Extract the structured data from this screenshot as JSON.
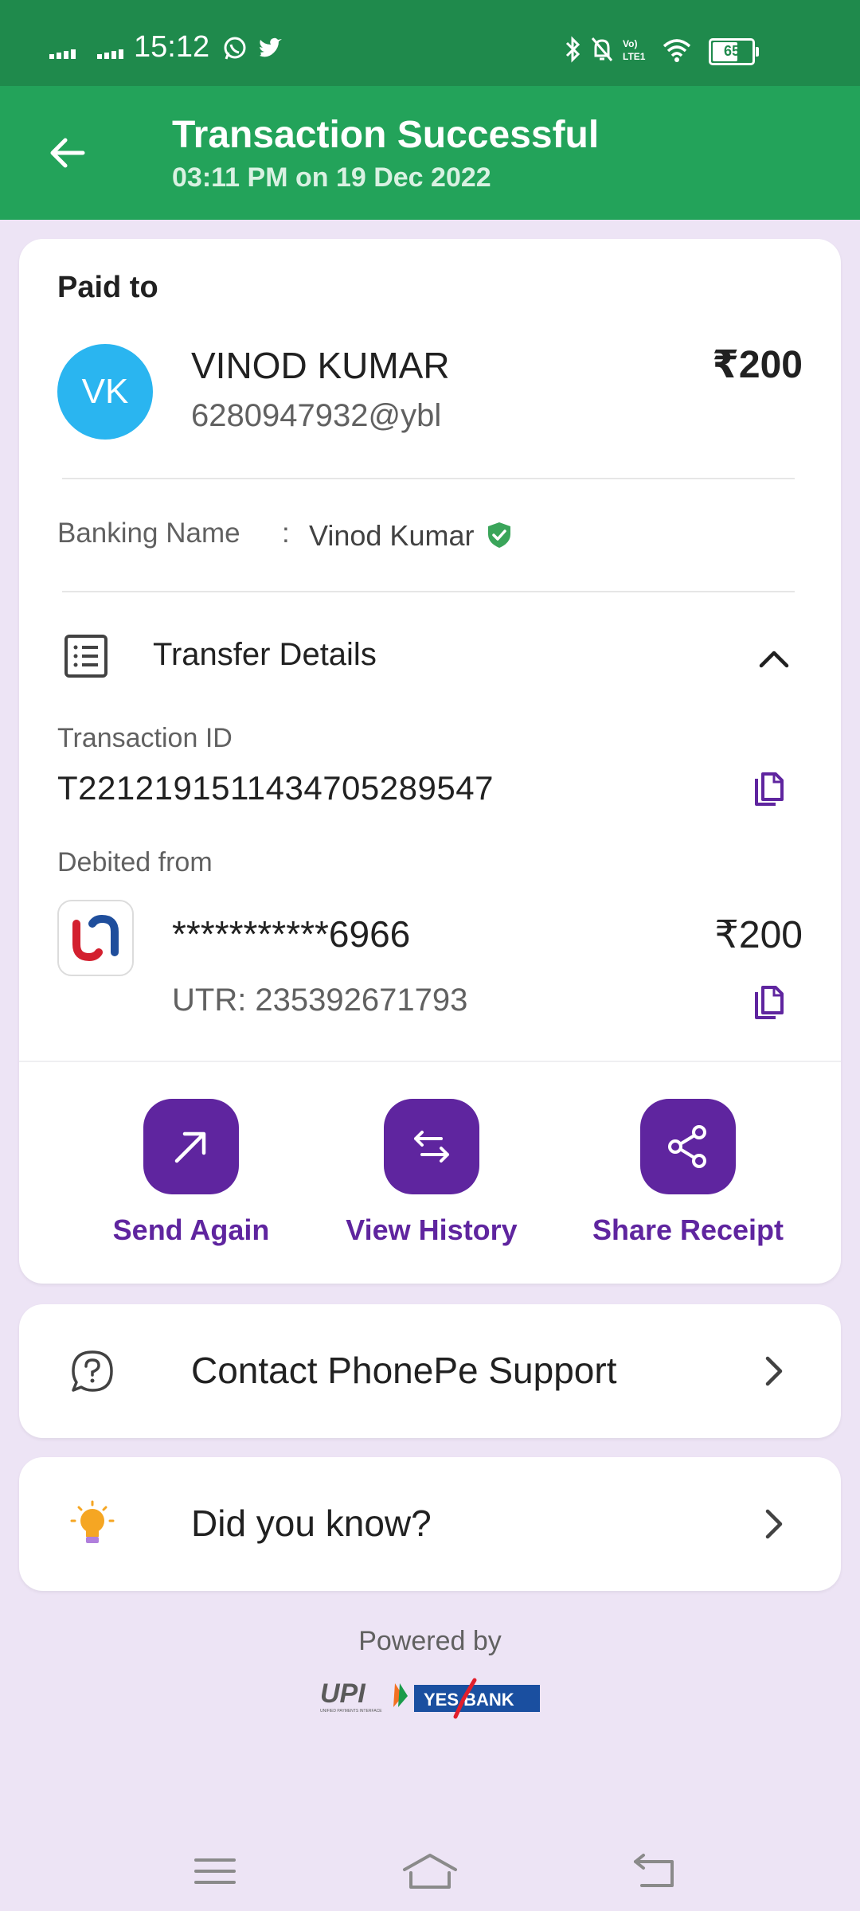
{
  "status_bar": {
    "time": "15:12",
    "battery": "65"
  },
  "header": {
    "title": "Transaction Successful",
    "subtitle": "03:11 PM on 19 Dec 2022"
  },
  "payee": {
    "section_label": "Paid to",
    "initials": "VK",
    "name": "VINOD KUMAR",
    "upi": "6280947932@ybl",
    "amount": "₹200",
    "banking_name_label": "Banking Name",
    "banking_name_sep": ":",
    "banking_name": "Vinod Kumar"
  },
  "transfer": {
    "title": "Transfer Details",
    "txn_label": "Transaction ID",
    "txn_id": "T2212191511434705289547",
    "debited_label": "Debited from",
    "account": "***********6966",
    "amount": "₹200",
    "utr": "UTR: 235392671793"
  },
  "actions": [
    {
      "label": "Send Again",
      "icon": "arrow-up-right-icon"
    },
    {
      "label": "View History",
      "icon": "arrows-swap-icon"
    },
    {
      "label": "Share Receipt",
      "icon": "share-icon"
    }
  ],
  "support": {
    "label": "Contact PhonePe Support",
    "icon": "help-chat-icon"
  },
  "know": {
    "label": "Did you know?",
    "icon": "bulb-icon"
  },
  "footer": {
    "powered_by": "Powered by",
    "logo_text_1": "UPI",
    "logo_text_1_sub": "UNIFIED PAYMENTS INTERFACE",
    "logo_text_2": "YES BANK"
  },
  "colors": {
    "header_green": "#23a35a",
    "status_green": "#1f8a4c",
    "brand_purple": "#5f259f",
    "background": "#ede4f5",
    "avatar_blue": "#2ab5f0"
  }
}
